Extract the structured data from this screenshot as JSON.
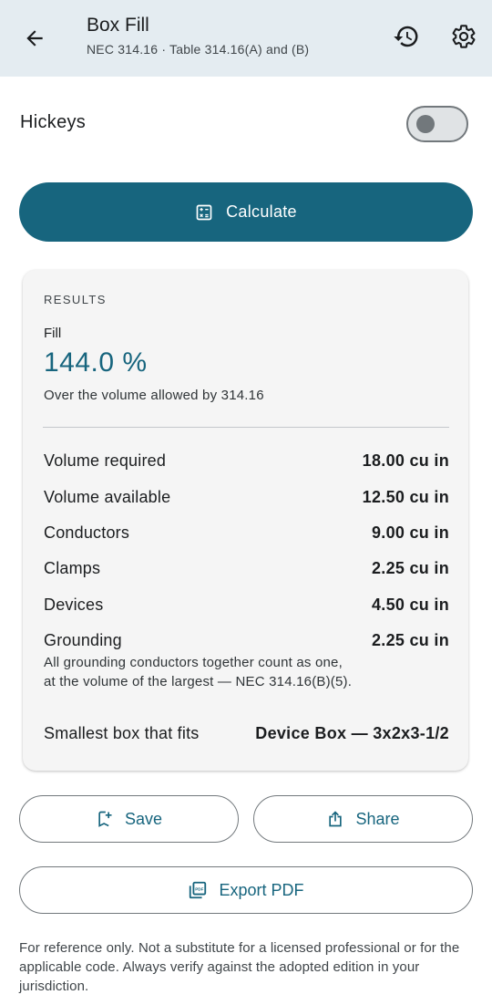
{
  "header": {
    "title": "Box Fill",
    "subtitle": "NEC 314.16 · Table 314.16(A) and (B)",
    "icons": [
      "arrow-back-icon",
      "history-icon",
      "gear-icon"
    ]
  },
  "hickeys": {
    "label": "Hickeys",
    "enabled": false
  },
  "calculate_button": {
    "label": "Calculate",
    "icon": "calculator-icon"
  },
  "results": {
    "heading": "RESULTS",
    "fill_label": "Fill",
    "fill_value": "144.0 %",
    "fill_note": "Over the volume allowed by 314.16",
    "rows": [
      {
        "label": "Volume required",
        "value": "18.00 cu in"
      },
      {
        "label": "Volume available",
        "value": "12.50 cu in"
      },
      {
        "label": "Conductors",
        "value": "9.00 cu in"
      },
      {
        "label": "Clamps",
        "value": "2.25 cu in"
      },
      {
        "label": "Devices",
        "value": "4.50 cu in"
      },
      {
        "label": "Grounding",
        "value": "2.25 cu in",
        "note": "All grounding conductors together count as one, at the volume of the largest — NEC 314.16(B)(5)."
      },
      {
        "label": "Smallest box that fits",
        "value": "Device Box — 3x2x3-1/2"
      }
    ]
  },
  "actions": {
    "save_label": "Save",
    "share_label": "Share",
    "export_label": "Export PDF"
  },
  "disclaimer": "For reference only. Not a substitute for a licensed professional or for the applicable code. Always verify against the adopted edition in your jurisdiction.",
  "colors": {
    "accent": "#17657e",
    "appbar": "#e4ecf1",
    "card": "#f5f5f5"
  }
}
